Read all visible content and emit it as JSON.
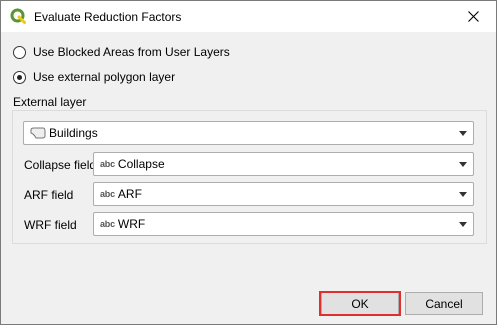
{
  "window": {
    "title": "Evaluate Reduction Factors"
  },
  "options": {
    "blocked_areas_label": "Use Blocked Areas from User Layers",
    "external_polygon_label": "Use external polygon layer",
    "selected": "external_polygon"
  },
  "external_layer": {
    "group_label": "External layer",
    "layer_value": "Buildings",
    "fields": [
      {
        "label": "Collapse field",
        "type_badge": "abc",
        "value": "Collapse"
      },
      {
        "label": "ARF field",
        "type_badge": "abc",
        "value": "ARF"
      },
      {
        "label": "WRF field",
        "type_badge": "abc",
        "value": "WRF"
      }
    ]
  },
  "buttons": {
    "ok_label": "OK",
    "cancel_label": "Cancel"
  },
  "colors": {
    "highlight": "#e0302e",
    "qgis_green": "#589632",
    "qgis_yellow": "#eec90d"
  }
}
